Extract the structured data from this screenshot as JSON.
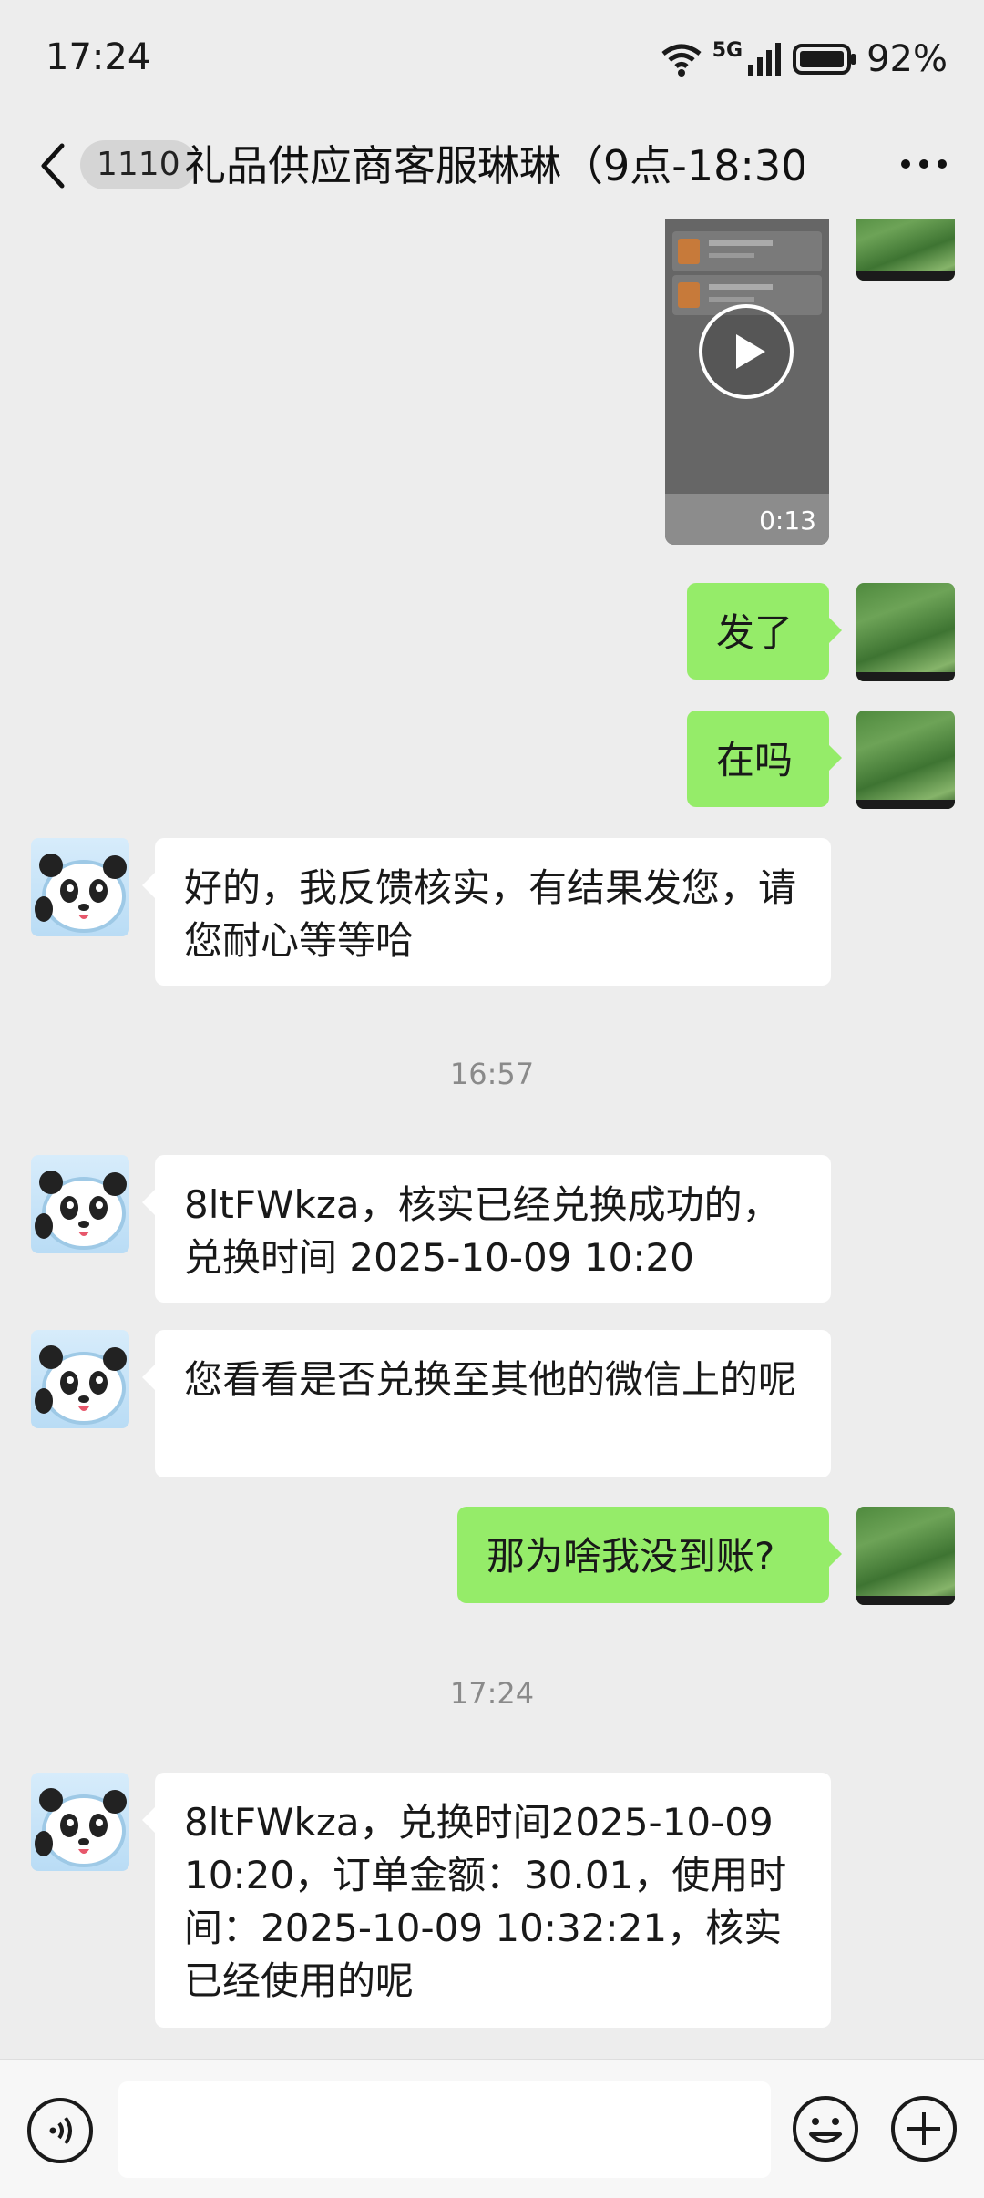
{
  "status_bar": {
    "time": "17:24",
    "network": "5G",
    "battery": "92%"
  },
  "nav": {
    "unread_count": "1110",
    "title": "礼品供应商客服琳琳（9点-18:30"
  },
  "messages": {
    "video_duration": "0:13",
    "m1": "发了",
    "m2": "在吗",
    "m3": "好的，我反馈核实，有结果发您，请您耐心等等哈",
    "ts1": "16:57",
    "m4": "8ltFWkza，核实已经兑换成功的，兑换时间 2025-10-09 10:20",
    "m5": "您看看是否兑换至其他的微信上的呢",
    "m6": "那为啥我没到账?",
    "ts2": "17:24",
    "m7": "8ltFWkza，兑换时间2025-10-09 10:20，订单金额：30.01，使用时间：2025-10-09 10:32:21，核实已经使用的呢"
  },
  "colors": {
    "self_bubble": "#95ec69",
    "other_bubble": "#ffffff",
    "background": "#ededed"
  }
}
